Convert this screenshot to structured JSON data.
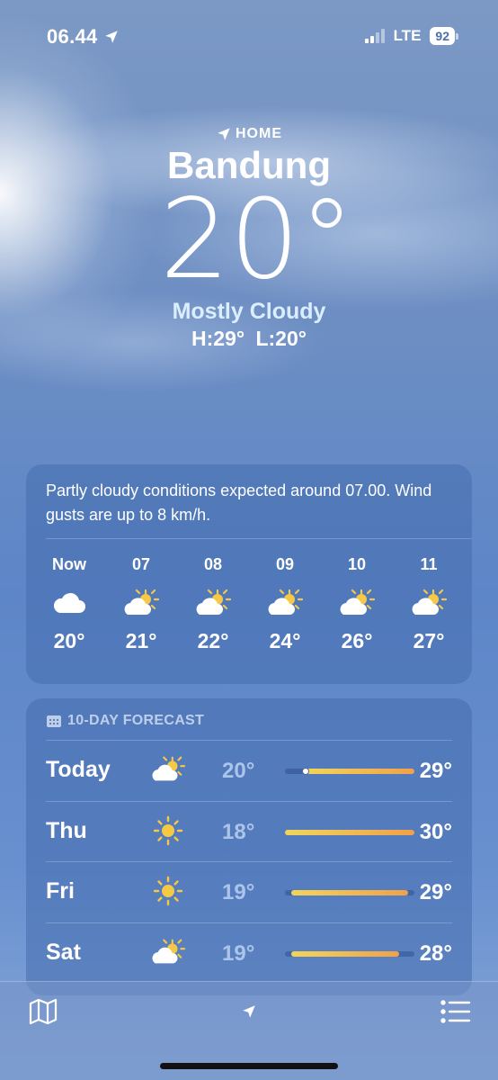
{
  "status_bar": {
    "time": "06.44",
    "network": "LTE",
    "battery": "92"
  },
  "hero": {
    "home_label": "HOME",
    "city": "Bandung",
    "temperature": "20°",
    "condition": "Mostly Cloudy",
    "high_low": "H:29° L:20°"
  },
  "hourly": {
    "summary": "Partly cloudy conditions expected around 07.00. Wind gusts are up to 8 km/h.",
    "hours": [
      {
        "label": "Now",
        "icon": "cloud-icon",
        "temp": "20°"
      },
      {
        "label": "07",
        "icon": "partly-sunny-icon",
        "temp": "21°"
      },
      {
        "label": "08",
        "icon": "partly-sunny-icon",
        "temp": "22°"
      },
      {
        "label": "09",
        "icon": "partly-sunny-icon",
        "temp": "24°"
      },
      {
        "label": "10",
        "icon": "partly-sunny-icon",
        "temp": "26°"
      },
      {
        "label": "11",
        "icon": "partly-sunny-icon",
        "temp": "27°"
      }
    ]
  },
  "forecast": {
    "header": "10-DAY FORECAST",
    "days": [
      {
        "day": "Today",
        "icon": "partly-sunny-icon",
        "low": "20°",
        "high": "29°",
        "range_start": 0.16,
        "range_end": 1.0,
        "current": 0.16
      },
      {
        "day": "Thu",
        "icon": "sun-icon",
        "low": "18°",
        "high": "30°",
        "range_start": 0.0,
        "range_end": 1.0
      },
      {
        "day": "Fri",
        "icon": "sun-icon",
        "low": "19°",
        "high": "29°",
        "range_start": 0.05,
        "range_end": 0.95
      },
      {
        "day": "Sat",
        "icon": "partly-sunny-icon",
        "low": "19°",
        "high": "28°",
        "range_start": 0.05,
        "range_end": 0.88
      }
    ]
  },
  "colors": {
    "condition_text": "#dbeeff",
    "bar_start": "#f2d55a",
    "bar_end": "#f0a14a"
  }
}
